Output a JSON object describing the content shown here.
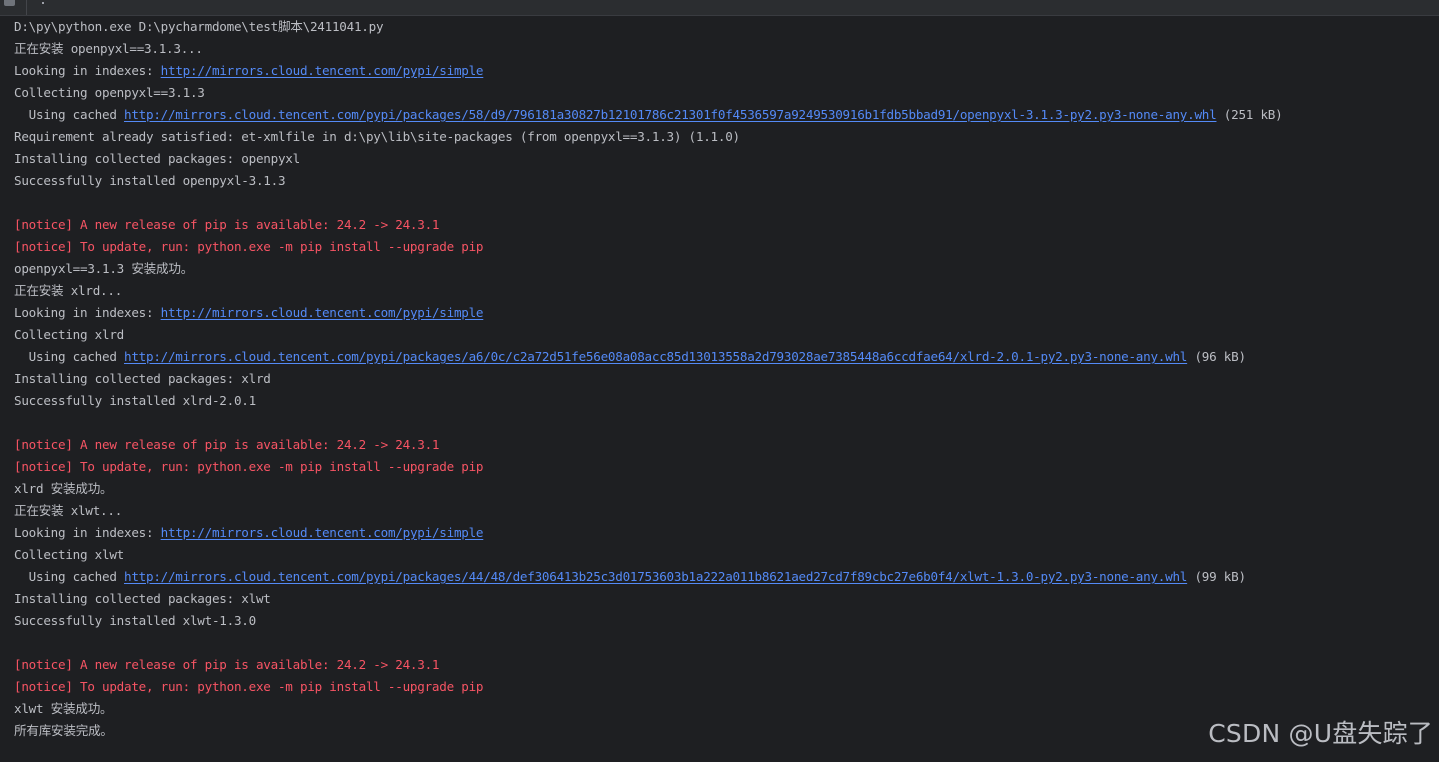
{
  "toolbar": {
    "overflow_label": "·"
  },
  "console": {
    "lines": [
      {
        "type": "text",
        "parts": [
          {
            "text": "D:\\py\\python.exe D:\\pycharmdome\\test脚本\\2411041.py"
          }
        ]
      },
      {
        "type": "text",
        "parts": [
          {
            "text": "正在安装 openpyxl==3.1.3..."
          }
        ]
      },
      {
        "type": "text",
        "parts": [
          {
            "text": "Looking in indexes: "
          },
          {
            "text": "http://mirrors.cloud.tencent.com/pypi/simple",
            "link": true
          }
        ]
      },
      {
        "type": "text",
        "parts": [
          {
            "text": "Collecting openpyxl==3.1.3"
          }
        ]
      },
      {
        "type": "text",
        "parts": [
          {
            "text": "  Using cached "
          },
          {
            "text": "http://mirrors.cloud.tencent.com/pypi/packages/58/d9/796181a30827b12101786c21301f0f4536597a9249530916b1fdb5bbad91/openpyxl-3.1.3-py2.py3-none-any.whl",
            "link": true
          },
          {
            "text": " (251 kB)"
          }
        ]
      },
      {
        "type": "text",
        "parts": [
          {
            "text": "Requirement already satisfied: et-xmlfile in d:\\py\\lib\\site-packages (from openpyxl==3.1.3) (1.1.0)"
          }
        ]
      },
      {
        "type": "text",
        "parts": [
          {
            "text": "Installing collected packages: openpyxl"
          }
        ]
      },
      {
        "type": "text",
        "parts": [
          {
            "text": "Successfully installed openpyxl-3.1.3"
          }
        ]
      },
      {
        "type": "text",
        "parts": [
          {
            "text": ""
          }
        ]
      },
      {
        "type": "err",
        "parts": [
          {
            "text": "[notice] A new release of pip is available: 24.2 -> 24.3.1"
          }
        ]
      },
      {
        "type": "err",
        "parts": [
          {
            "text": "[notice] To update, run: python.exe -m pip install --upgrade pip"
          }
        ]
      },
      {
        "type": "text",
        "parts": [
          {
            "text": "openpyxl==3.1.3 安装成功。"
          }
        ]
      },
      {
        "type": "text",
        "parts": [
          {
            "text": "正在安装 xlrd..."
          }
        ]
      },
      {
        "type": "text",
        "parts": [
          {
            "text": "Looking in indexes: "
          },
          {
            "text": "http://mirrors.cloud.tencent.com/pypi/simple",
            "link": true
          }
        ]
      },
      {
        "type": "text",
        "parts": [
          {
            "text": "Collecting xlrd"
          }
        ]
      },
      {
        "type": "text",
        "parts": [
          {
            "text": "  Using cached "
          },
          {
            "text": "http://mirrors.cloud.tencent.com/pypi/packages/a6/0c/c2a72d51fe56e08a08acc85d13013558a2d793028ae7385448a6ccdfae64/xlrd-2.0.1-py2.py3-none-any.whl",
            "link": true
          },
          {
            "text": " (96 kB)"
          }
        ]
      },
      {
        "type": "text",
        "parts": [
          {
            "text": "Installing collected packages: xlrd"
          }
        ]
      },
      {
        "type": "text",
        "parts": [
          {
            "text": "Successfully installed xlrd-2.0.1"
          }
        ]
      },
      {
        "type": "text",
        "parts": [
          {
            "text": ""
          }
        ]
      },
      {
        "type": "err",
        "parts": [
          {
            "text": "[notice] A new release of pip is available: 24.2 -> 24.3.1"
          }
        ]
      },
      {
        "type": "err",
        "parts": [
          {
            "text": "[notice] To update, run: python.exe -m pip install --upgrade pip"
          }
        ]
      },
      {
        "type": "text",
        "parts": [
          {
            "text": "xlrd 安装成功。"
          }
        ]
      },
      {
        "type": "text",
        "parts": [
          {
            "text": "正在安装 xlwt..."
          }
        ]
      },
      {
        "type": "text",
        "parts": [
          {
            "text": "Looking in indexes: "
          },
          {
            "text": "http://mirrors.cloud.tencent.com/pypi/simple",
            "link": true
          }
        ]
      },
      {
        "type": "text",
        "parts": [
          {
            "text": "Collecting xlwt"
          }
        ]
      },
      {
        "type": "text",
        "parts": [
          {
            "text": "  Using cached "
          },
          {
            "text": "http://mirrors.cloud.tencent.com/pypi/packages/44/48/def306413b25c3d01753603b1a222a011b8621aed27cd7f89cbc27e6b0f4/xlwt-1.3.0-py2.py3-none-any.whl",
            "link": true
          },
          {
            "text": " (99 kB)"
          }
        ]
      },
      {
        "type": "text",
        "parts": [
          {
            "text": "Installing collected packages: xlwt"
          }
        ]
      },
      {
        "type": "text",
        "parts": [
          {
            "text": "Successfully installed xlwt-1.3.0"
          }
        ]
      },
      {
        "type": "text",
        "parts": [
          {
            "text": ""
          }
        ]
      },
      {
        "type": "err",
        "parts": [
          {
            "text": "[notice] A new release of pip is available: 24.2 -> 24.3.1"
          }
        ]
      },
      {
        "type": "err",
        "parts": [
          {
            "text": "[notice] To update, run: python.exe -m pip install --upgrade pip"
          }
        ]
      },
      {
        "type": "text",
        "parts": [
          {
            "text": "xlwt 安装成功。"
          }
        ]
      },
      {
        "type": "text",
        "parts": [
          {
            "text": "所有库安装完成。"
          }
        ]
      }
    ]
  },
  "watermark": {
    "text": "CSDN @U盘失踪了"
  },
  "colors": {
    "background": "#1e1f22",
    "text": "#bcbec4",
    "error": "#f75464",
    "link": "#548af7"
  }
}
